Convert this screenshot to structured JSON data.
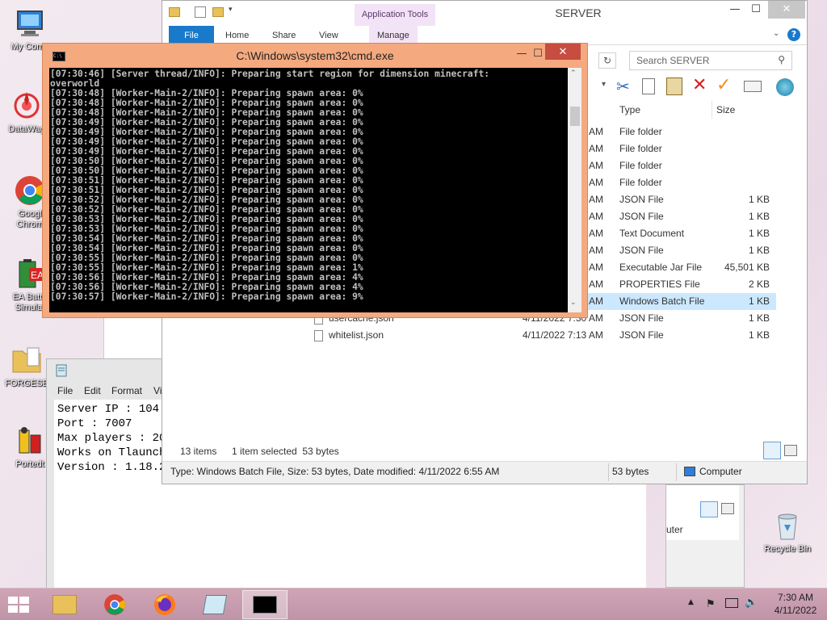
{
  "desktop_icons": [
    {
      "label": "My Comp",
      "icon": "computer-icon"
    },
    {
      "label": "DataWag",
      "icon": "datawag-icon"
    },
    {
      "label": "Googl\nChrom",
      "icon": "chrome-icon"
    },
    {
      "label": "EA Batte\nSimulat",
      "icon": "battery-app-icon"
    },
    {
      "label": "FORGESE",
      "icon": "folder-icon"
    },
    {
      "label": "Portedt",
      "icon": "ported-app-icon"
    },
    {
      "label": "Recycle Bin",
      "icon": "recycle-bin-icon"
    }
  ],
  "explorer": {
    "title": "SERVER",
    "app_tools_label": "Application Tools",
    "tabs": [
      "File",
      "Home",
      "Share",
      "View",
      "Manage"
    ],
    "search_placeholder": "Search SERVER",
    "columns": {
      "type": "Type",
      "size": "Size"
    },
    "rows": [
      {
        "name": "",
        "date": "AM",
        "type": "File folder",
        "size": ""
      },
      {
        "name": "",
        "date": "AM",
        "type": "File folder",
        "size": ""
      },
      {
        "name": "",
        "date": "AM",
        "type": "File folder",
        "size": ""
      },
      {
        "name": "",
        "date": "AM",
        "type": "File folder",
        "size": ""
      },
      {
        "name": "",
        "date": "AM",
        "type": "JSON File",
        "size": "1 KB"
      },
      {
        "name": "",
        "date": "AM",
        "type": "JSON File",
        "size": "1 KB"
      },
      {
        "name": "",
        "date": "AM",
        "type": "Text Document",
        "size": "1 KB"
      },
      {
        "name": "",
        "date": "AM",
        "type": "JSON File",
        "size": "1 KB"
      },
      {
        "name": "",
        "date": "AM",
        "type": "Executable Jar File",
        "size": "45,501 KB"
      },
      {
        "name": "",
        "date": "AM",
        "type": "PROPERTIES File",
        "size": "2 KB"
      },
      {
        "name": "",
        "date": "AM",
        "type": "Windows Batch File",
        "size": "1 KB"
      },
      {
        "name": "usercache.json",
        "date": "4/11/2022 7:30 AM",
        "type": "JSON File",
        "size": "1 KB"
      },
      {
        "name": "whitelist.json",
        "date": "4/11/2022 7:13 AM",
        "type": "JSON File",
        "size": "1 KB"
      }
    ],
    "status": {
      "items": "13 items",
      "selected": "1 item selected  53 bytes"
    },
    "details_bar": {
      "text": "Type: Windows Batch File, Size: 53 bytes, Date modified: 4/11/2022 6:55 AM",
      "size": "53 bytes",
      "location": "Computer"
    },
    "behind_window_text": "uter"
  },
  "cmd": {
    "title": "C:\\Windows\\system32\\cmd.exe",
    "icon_text": "C:\\",
    "lines": [
      "[07:30:46] [Server thread/INFO]: Preparing start region for dimension minecraft:",
      "overworld",
      "[07:30:48] [Worker-Main-2/INFO]: Preparing spawn area: 0%",
      "[07:30:48] [Worker-Main-2/INFO]: Preparing spawn area: 0%",
      "[07:30:48] [Worker-Main-2/INFO]: Preparing spawn area: 0%",
      "[07:30:49] [Worker-Main-2/INFO]: Preparing spawn area: 0%",
      "[07:30:49] [Worker-Main-2/INFO]: Preparing spawn area: 0%",
      "[07:30:49] [Worker-Main-2/INFO]: Preparing spawn area: 0%",
      "[07:30:49] [Worker-Main-2/INFO]: Preparing spawn area: 0%",
      "[07:30:50] [Worker-Main-2/INFO]: Preparing spawn area: 0%",
      "[07:30:50] [Worker-Main-2/INFO]: Preparing spawn area: 0%",
      "[07:30:51] [Worker-Main-2/INFO]: Preparing spawn area: 0%",
      "[07:30:51] [Worker-Main-2/INFO]: Preparing spawn area: 0%",
      "[07:30:52] [Worker-Main-2/INFO]: Preparing spawn area: 0%",
      "[07:30:52] [Worker-Main-2/INFO]: Preparing spawn area: 0%",
      "[07:30:53] [Worker-Main-2/INFO]: Preparing spawn area: 0%",
      "[07:30:53] [Worker-Main-2/INFO]: Preparing spawn area: 0%",
      "[07:30:54] [Worker-Main-2/INFO]: Preparing spawn area: 0%",
      "[07:30:54] [Worker-Main-2/INFO]: Preparing spawn area: 0%",
      "[07:30:55] [Worker-Main-2/INFO]: Preparing spawn area: 0%",
      "[07:30:55] [Worker-Main-2/INFO]: Preparing spawn area: 1%",
      "[07:30:56] [Worker-Main-2/INFO]: Preparing spawn area: 4%",
      "[07:30:56] [Worker-Main-2/INFO]: Preparing spawn area: 4%",
      "[07:30:57] [Worker-Main-2/INFO]: Preparing spawn area: 9%"
    ]
  },
  "notepad": {
    "menu": [
      "File",
      "Edit",
      "Format",
      "Vi"
    ],
    "lines": [
      "Server IP : 104.",
      "Port : 7007",
      "Max players : 20",
      "Works on Tlaunch",
      "Version : 1.18.2"
    ]
  },
  "taskbar": {
    "apps": [
      "explorer-icon",
      "chrome-icon",
      "firefox-icon",
      "notepad-icon",
      "cmd-icon"
    ],
    "time": "7:30 AM",
    "date": "4/11/2022"
  },
  "colors": {
    "cmd_frame": "#f4a97f",
    "accent_blue": "#1979ca",
    "selection": "#cce8ff",
    "taskbar": "#c79caf"
  }
}
